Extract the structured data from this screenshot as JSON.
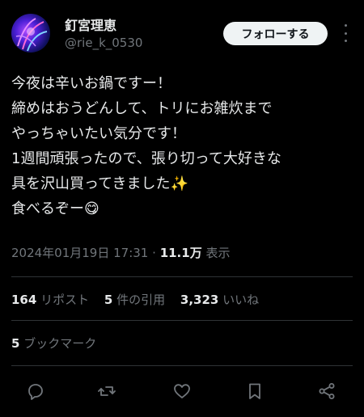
{
  "author": {
    "display_name": "釘宮理恵",
    "handle": "@rie_k_0530",
    "avatar_icon": "avatar-image"
  },
  "follow_label": "フォローする",
  "tweet_lines": [
    "今夜は辛いお鍋ですー！",
    "締めはおうどんして、トリにお雑炊まで",
    "やっちゃいたい気分です！",
    "1週間頑張ったので、張り切って大好きな",
    "具を沢山買ってきました✨",
    "食べるぞー😋"
  ],
  "meta": {
    "timestamp": "2024年01月19日 17:31",
    "separator": "·",
    "views": "11.1万",
    "views_label": "表示"
  },
  "stats": {
    "reposts_count": "164",
    "reposts_label": "リポスト",
    "quotes_count": "5",
    "quotes_label": "件の引用",
    "likes_count": "3,323",
    "likes_label": "いいね"
  },
  "bookmarks": {
    "count": "5",
    "label": "ブックマーク"
  },
  "actions": [
    "reply-icon",
    "repost-icon",
    "like-icon",
    "bookmark-icon",
    "share-icon"
  ],
  "colors": {
    "background": "#000000",
    "text": "#e7e9ea",
    "secondary": "#71767b",
    "divider": "#2f3336",
    "button_bg": "#eff3f4"
  }
}
